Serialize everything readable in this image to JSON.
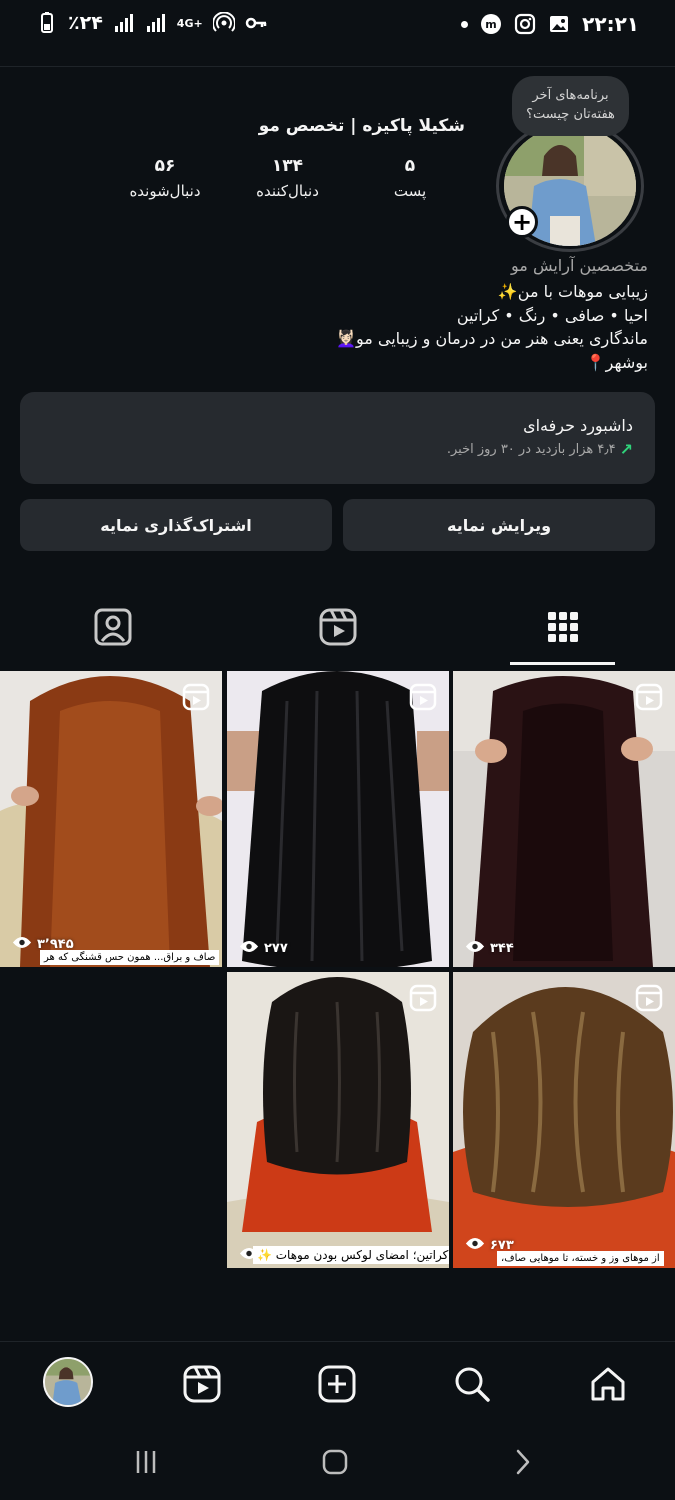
{
  "status_bar": {
    "battery": "٪۲۴",
    "network_type": "4G+",
    "time": "۲۲:۲۱",
    "icons_left": [
      "battery-icon",
      "signal-icon",
      "signal-icon",
      "network-4g-icon",
      "hotspot-icon",
      "key-icon"
    ],
    "icons_right": [
      "dot-icon",
      "app-m-icon",
      "instagram-icon",
      "gallery-icon"
    ]
  },
  "profile": {
    "display_name": "شکیلا پاکیزه | تخصص مو",
    "note_bubble": "برنامه‌های آخر هفته‌تان چیست؟",
    "stats": [
      {
        "value": "۵",
        "label": "پست"
      },
      {
        "value": "۱۳۴",
        "label": "دنبال‌کننده"
      },
      {
        "value": "۵۶",
        "label": "دنبال‌شونده"
      }
    ],
    "category": "متخصصین آرایش مو",
    "bio_lines": [
      "زیبایی موهات با من✨",
      "احیا • صافی • رنگ • کراتین",
      "ماندگاری یعنی هنر من در درمان و زیبایی مو💆🏻‍♀️",
      "بوشهر📍"
    ]
  },
  "dashboard": {
    "title": "داشبورد حرفه‌ای",
    "subtitle": "۴٫۴ هزار بازدید در ۳۰ روز اخیر."
  },
  "actions": {
    "edit_label": "ویرایش نمایه",
    "share_label": "اشتراک‌گذاری نمایه"
  },
  "tabs": {
    "active": "grid",
    "items": [
      "grid-icon",
      "reels-icon",
      "tagged-icon"
    ]
  },
  "posts": [
    {
      "views": "۳۴۴",
      "caption": ""
    },
    {
      "views": "۲۷۷",
      "caption": ""
    },
    {
      "views": "۳٬۹۴۵",
      "caption": "صاف و براق... همون حس قشنگی که هر"
    },
    {
      "views": "۶۷۳",
      "caption": "از موهای وز و خسته، تا موهایی صاف،"
    },
    {
      "views": "",
      "caption": "کراتین؛ امضای لوکس بودن موهات ✨"
    }
  ],
  "bottom_nav": [
    "home-icon",
    "search-icon",
    "create-icon",
    "reels-icon",
    "profile-avatar"
  ],
  "system_nav": [
    "recents-icon",
    "home-circle-icon",
    "back-icon"
  ]
}
